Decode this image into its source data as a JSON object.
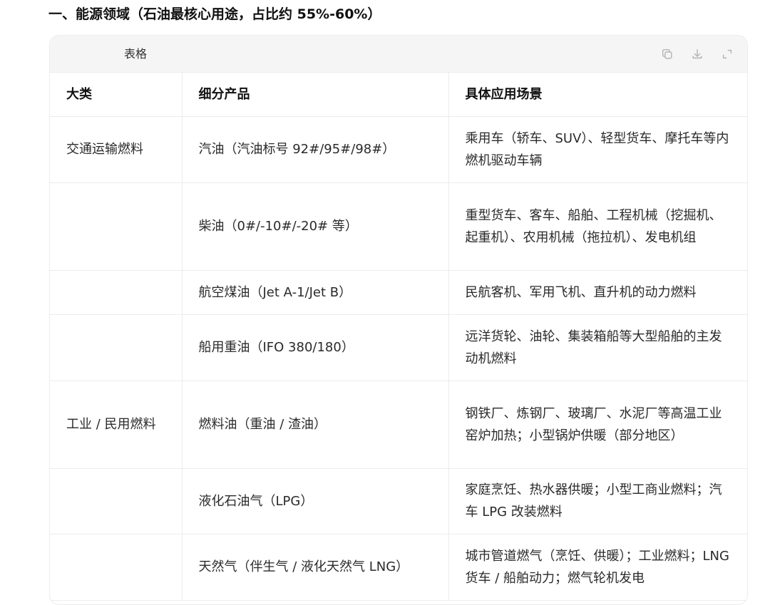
{
  "heading": "一、能源领域（石油最核心用途，占比约 55%-60%）",
  "card": {
    "title": "表格",
    "tools": [
      "copy-icon",
      "download-icon",
      "expand-icon"
    ]
  },
  "table": {
    "headers": [
      "大类",
      "细分产品",
      "具体应用场景"
    ],
    "rows": [
      {
        "category": "交通运输燃料",
        "product": "汽油（汽油标号 92#/95#/98#）",
        "scene": "乘用车（轿车、SUV）、轻型货车、摩托车等内燃机驱动车辆"
      },
      {
        "category": "",
        "product": "柴油（0#/-10#/-20# 等）",
        "scene": "重型货车、客车、船舶、工程机械（挖掘机、起重机）、农用机械（拖拉机）、发电机组"
      },
      {
        "category": "",
        "product": "航空煤油（Jet A-1/Jet B）",
        "scene": "民航客机、军用飞机、直升机的动力燃料"
      },
      {
        "category": "",
        "product": "船用重油（IFO 380/180）",
        "scene": "远洋货轮、油轮、集装箱船等大型船舶的主发动机燃料"
      },
      {
        "category": "工业 / 民用燃料",
        "product": "燃料油（重油 / 渣油）",
        "scene": "钢铁厂、炼钢厂、玻璃厂、水泥厂等高温工业窑炉加热；小型锅炉供暖（部分地区）"
      },
      {
        "category": "",
        "product": "液化石油气（LPG）",
        "scene": "家庭烹饪、热水器供暖；小型工商业燃料；汽车 LPG 改装燃料"
      },
      {
        "category": "",
        "product": "天然气（伴生气 / 液化天然气 LNG）",
        "scene": "城市管道燃气（烹饪、供暖）；工业燃料；LNG 货车 / 船舶动力；燃气轮机发电"
      }
    ]
  }
}
